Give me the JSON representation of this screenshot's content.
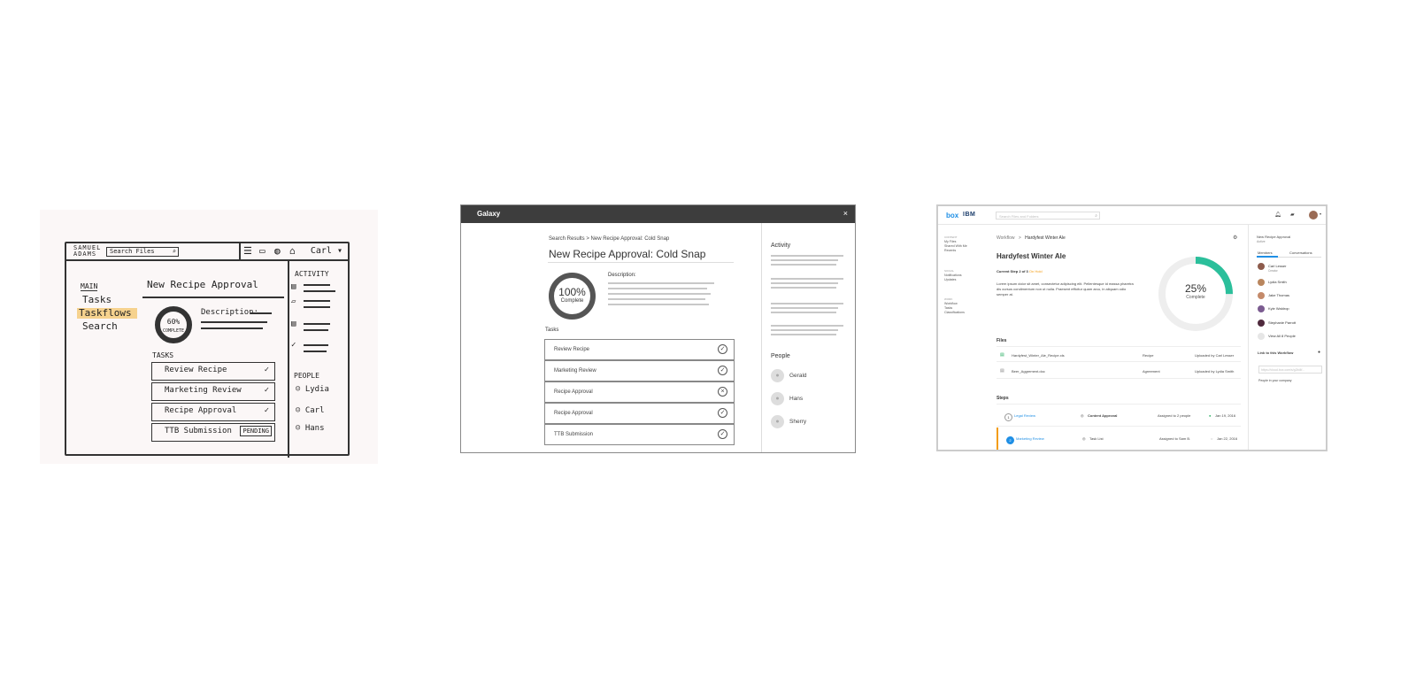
{
  "sketch": {
    "brand": "SAMUEL ADAMS",
    "search_placeholder": "Search Files",
    "user": "Carl",
    "user_caret": "▾",
    "main_label": "MAIN",
    "nav": [
      "Tasks",
      "Taskflows",
      "Search"
    ],
    "title": "New Recipe Approval",
    "ring_pct": "60%",
    "ring_label": "COMPLETE",
    "description_label": "Description:",
    "tasks_label": "TASKS",
    "tasks": [
      {
        "name": "Review Recipe",
        "status": "✓"
      },
      {
        "name": "Marketing Review",
        "status": "✓"
      },
      {
        "name": "Recipe Approval",
        "status": "✓"
      },
      {
        "name": "TTB Submission",
        "status": "PENDING"
      }
    ],
    "activity_label": "ACTIVITY",
    "people_label": "PEOPLE",
    "people": [
      "Lydia",
      "Carl",
      "Hans"
    ],
    "icons": [
      "checklist-icon",
      "folder-icon",
      "globe-icon",
      "inbox-icon"
    ]
  },
  "galaxy": {
    "title": "Galaxy",
    "close": "×",
    "breadcrumb": "Search Results > New Recipe Approval: Cold Snap",
    "heading": "New Recipe Approval: Cold Snap",
    "progress_pct": "100%",
    "progress_label": "Complete",
    "description_label": "Description:",
    "tasks_label": "Tasks",
    "tasks": [
      {
        "name": "Review Recipe",
        "status": "✓"
      },
      {
        "name": "Marketing Review",
        "status": "✓"
      },
      {
        "name": "Recipe Approval",
        "status": "×"
      },
      {
        "name": "Recipe Approval",
        "status": "✓"
      },
      {
        "name": "TTB Submission",
        "status": "✓"
      }
    ],
    "activity_label": "Activity",
    "people_label": "People",
    "people": [
      "Gerald",
      "Hans",
      "Sherry"
    ]
  },
  "box": {
    "logo": "box",
    "ibm": "IBM",
    "search_placeholder": "Search Files and Folders",
    "nav": {
      "content_label": "CONTENT",
      "content": [
        "My Files",
        "Shared With Me",
        "Recents"
      ],
      "social_label": "SOCIAL",
      "social": [
        "Notifications",
        "Updates"
      ],
      "work_label": "WORK",
      "work": [
        "Workflow",
        "Tasks",
        "Classifications"
      ]
    },
    "breadcrumb_root": "Workflow",
    "breadcrumb_sep": ">",
    "breadcrumb_current": "Hardyfest Winter Ale",
    "title": "Hardyfest Winter Ale",
    "current_step_label": "Current Step 2 of 3",
    "current_step_status": "On Hold",
    "lorem": "Lorem ipsum dolor sit amet, consectetur adipiscing elit. Pellentesque id massa pharetra dis cursus condimentum non ut nulla. Praesent efficitur quam arcu, in aliquam odio semper at.",
    "progress_pct": "25%",
    "progress_label": "Complete",
    "progress_value": 0.25,
    "accent": "#2bbf9b",
    "files_label": "Files",
    "files": [
      {
        "name": "Hardyfest_Winter_Ale_Recipe.xls",
        "type": "Recipe",
        "uploader": "Uploaded by Carl Lesser"
      },
      {
        "name": "Beer_Aggrement.doc",
        "type": "Agreement",
        "uploader": "Uploaded by Lydia Smith"
      }
    ],
    "steps_label": "Steps",
    "steps": [
      {
        "num": "1",
        "name": "Legal Review",
        "kind": "Content Approval",
        "assigned": "Assigned to 2 people",
        "date": "Jan 19, 2016"
      },
      {
        "num": "2",
        "name": "Marketing Review",
        "kind": "Task List",
        "assigned": "Assigned to Sam B.",
        "date": "Jan 22, 2016"
      }
    ],
    "right": {
      "title": "New Recipe Approval",
      "status": "Active",
      "tab_members": "Members",
      "tab_conversations": "Conversations",
      "members": [
        {
          "name": "Carl Lesser",
          "role": "Creator"
        },
        {
          "name": "Lydia Smith",
          "role": ""
        },
        {
          "name": "Jake Thomas",
          "role": ""
        },
        {
          "name": "Kyle Waldrop",
          "role": ""
        },
        {
          "name": "Stephanie Parrott",
          "role": ""
        }
      ],
      "view_all": "View All 8 People",
      "link_label": "Link to this Workflow",
      "link_placeholder": "https://cloud.box.com/s/g2ld4f...",
      "people_link": "People in your company"
    }
  }
}
